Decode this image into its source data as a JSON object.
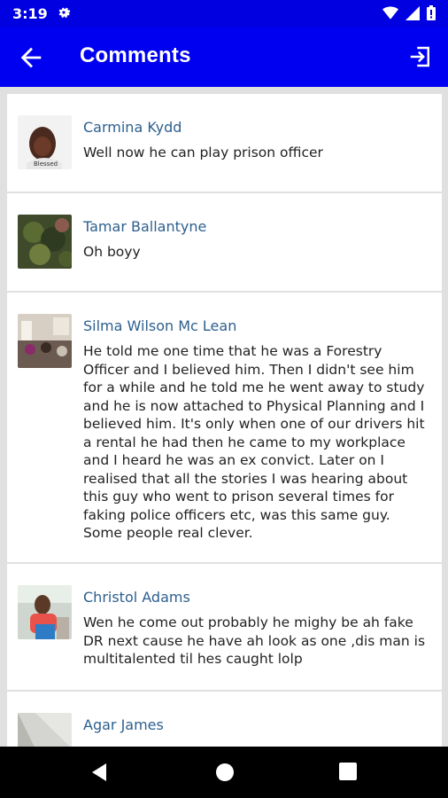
{
  "status_bar": {
    "time": "3:19",
    "gear_icon": "gear-icon",
    "wifi_icon": "wifi-icon",
    "signal_icon": "signal-icon",
    "battery_icon": "battery-icon"
  },
  "app_bar": {
    "title": "Comments",
    "back_icon": "arrow-back-icon",
    "logout_icon": "logout-icon"
  },
  "comments": [
    {
      "name": "Carmina Kydd",
      "text": "Well now he can play prison officer"
    },
    {
      "name": "Tamar Ballantyne",
      "text": "Oh boyy"
    },
    {
      "name": "Silma Wilson Mc Lean",
      "text": "He told me one time that he was a Forestry Officer and I believed him. Then I didn't see him for a while and he told me he went away to study and he is now attached to Physical Planning and I believed him. It's only when one of our drivers hit a rental he had then he came to my workplace and I heard he was an ex convict. Later on I realised that all the stories I was hearing about this guy who went to prison several times for faking police officers etc, was this same guy. Some people real clever."
    },
    {
      "name": "Christol Adams",
      "text": "Wen he come out probably he mighy be ah fake DR next cause he have ah look as one ,dis man is multitalented til hes caught lolp"
    },
    {
      "name": "Agar James",
      "text": ""
    }
  ],
  "colors": {
    "app_bar": "#0000f0",
    "status_bar": "#0000e0",
    "name": "#2d5f8e"
  }
}
